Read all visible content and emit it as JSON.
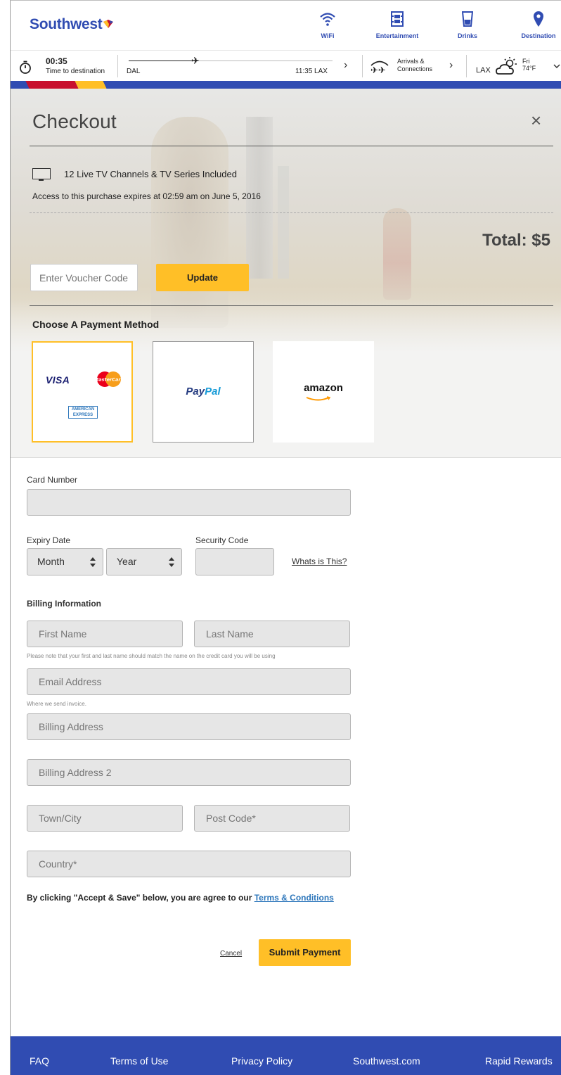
{
  "header": {
    "brand": "Southwest",
    "nav": [
      {
        "label": "WiFi",
        "icon": "wifi-icon"
      },
      {
        "label": "Entertainment",
        "icon": "film-icon"
      },
      {
        "label": "Drinks",
        "icon": "cup-icon"
      },
      {
        "label": "Destination",
        "icon": "map-pin-icon"
      }
    ]
  },
  "flight": {
    "time_to_destination": "00:35",
    "time_to_destination_label": "Time to destination",
    "origin": "DAL",
    "arrival": "11:35 LAX",
    "flight_progress": 0.34,
    "arrivals_label_1": "Arrivals &",
    "arrivals_label_2": "Connections",
    "destination_code": "LAX",
    "weather_day": "Fri",
    "weather_temp": "74°F"
  },
  "checkout": {
    "title": "Checkout",
    "close_icon": "×",
    "item_name": "12 Live TV Channels & TV Series Included",
    "expiry_note": "Access to this purchase expires at 02:59 am on June 5, 2016",
    "total": "Total: $5",
    "voucher_placeholder": "Enter Voucher Code",
    "update_label": "Update",
    "payment_heading": "Choose  A Payment Method",
    "payment_methods": [
      {
        "name": "Credit Card",
        "logos": [
          "VISA",
          "MasterCard",
          "AMERICAN EXPRESS"
        ],
        "selected": true
      },
      {
        "name": "PayPal",
        "logo_a": "Pay",
        "logo_b": "Pal",
        "selected": false
      },
      {
        "name": "Amazon",
        "logo": "amazon",
        "selected": false
      }
    ]
  },
  "form": {
    "card_number_label": "Card Number",
    "card_number_value": "",
    "expiry_label": "Expiry Date",
    "month_value": "Month",
    "year_value": "Year",
    "security_label": "Security Code",
    "security_value": "",
    "whats_this": "Whats is This?",
    "billing_heading": "Billing Information",
    "first_name_placeholder": "First Name",
    "last_name_placeholder": "Last Name",
    "name_note": "Please note that your first and last name should match the name on the credit card you will be using",
    "email_placeholder": "Email Address",
    "email_note": "Where we send invoice.",
    "address_placeholder": "Billing Address",
    "address2_placeholder": "Billing Address 2",
    "city_placeholder": "Town/City",
    "postcode_placeholder": "Post Code*",
    "country_placeholder": "Country*",
    "terms_text": "By clicking \"Accept & Save\" below, you are agree to our ",
    "terms_link": "Terms & Conditions",
    "cancel_label": "Cancel",
    "submit_label": "Submit Payment"
  },
  "footer": {
    "links": [
      "FAQ",
      "Terms of Use",
      "Privacy Policy",
      "Southwest.com",
      "Rapid Rewards"
    ]
  },
  "colors": {
    "brand_blue": "#304CB2",
    "accent_yellow": "#FFBF27",
    "brand_red": "#C8102E"
  }
}
